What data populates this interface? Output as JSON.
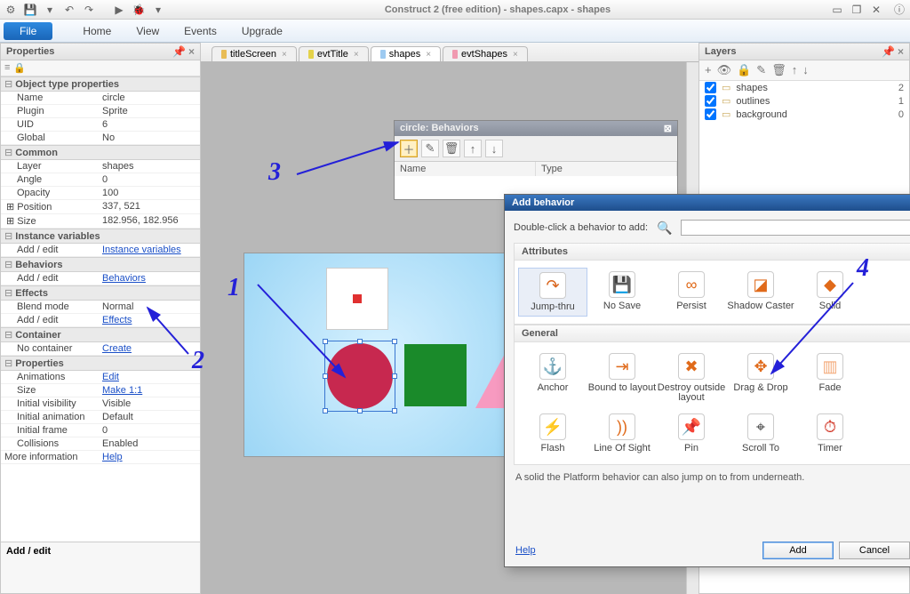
{
  "app_title": "Construct 2 (free edition) - shapes.capx - shapes",
  "menubar": {
    "file": "File",
    "items": [
      "Home",
      "View",
      "Events",
      "Upgrade"
    ]
  },
  "tabs": [
    {
      "label": "titleScreen",
      "color": "#e8bc55"
    },
    {
      "label": "evtTitle",
      "color": "#e4d24a"
    },
    {
      "label": "shapes",
      "color": "#9dcaf1",
      "active": true
    },
    {
      "label": "evtShapes",
      "color": "#f09ab0"
    }
  ],
  "props_panel": {
    "title": "Properties",
    "groups": [
      {
        "name": "Object type properties",
        "rows": [
          {
            "k": "Name",
            "v": "circle"
          },
          {
            "k": "Plugin",
            "v": "Sprite"
          },
          {
            "k": "UID",
            "v": "6"
          },
          {
            "k": "Global",
            "v": "No"
          }
        ]
      },
      {
        "name": "Common",
        "rows": [
          {
            "k": "Layer",
            "v": "shapes"
          },
          {
            "k": "Angle",
            "v": "0"
          },
          {
            "k": "Opacity",
            "v": "100"
          },
          {
            "k": "Position",
            "v": "337, 521",
            "exp": true
          },
          {
            "k": "Size",
            "v": "182.956, 182.956",
            "exp": true
          }
        ]
      },
      {
        "name": "Instance variables",
        "rows": [
          {
            "k": "Add / edit",
            "v": "Instance variables",
            "link": true
          }
        ]
      },
      {
        "name": "Behaviors",
        "rows": [
          {
            "k": "Add / edit",
            "v": "Behaviors",
            "link": true
          }
        ]
      },
      {
        "name": "Effects",
        "rows": [
          {
            "k": "Blend mode",
            "v": "Normal"
          },
          {
            "k": "Add / edit",
            "v": "Effects",
            "link": true
          }
        ]
      },
      {
        "name": "Container",
        "rows": [
          {
            "k": "No container",
            "v": "Create",
            "link": true
          }
        ]
      },
      {
        "name": "Properties",
        "rows": [
          {
            "k": "Animations",
            "v": "Edit",
            "link": true
          },
          {
            "k": "Size",
            "v": "Make 1:1",
            "link": true
          },
          {
            "k": "Initial visibility",
            "v": "Visible"
          },
          {
            "k": "Initial animation",
            "v": "Default"
          },
          {
            "k": "Initial frame",
            "v": "0"
          },
          {
            "k": "Collisions",
            "v": "Enabled"
          }
        ]
      }
    ],
    "more_info": {
      "k": "More information",
      "v": "Help"
    },
    "desc_title": "Add / edit"
  },
  "layers_panel": {
    "title": "Layers",
    "rows": [
      {
        "name": "shapes",
        "n": "2"
      },
      {
        "name": "outlines",
        "n": "1"
      },
      {
        "name": "background",
        "n": "0"
      }
    ]
  },
  "behaviors_dialog": {
    "title": "circle: Behaviors",
    "cols": [
      "Name",
      "Type"
    ]
  },
  "add_dialog": {
    "title": "Add behavior",
    "hint": "Double-click a behavior to add:",
    "search_placeholder": "",
    "sections": [
      {
        "title": "Attributes",
        "items": [
          {
            "label": "Jump-thru",
            "icon": "↷",
            "color": "#d9641b",
            "sel": true
          },
          {
            "label": "No Save",
            "icon": "💾",
            "color": "#555"
          },
          {
            "label": "Persist",
            "icon": "∞",
            "color": "#e06a1a"
          },
          {
            "label": "Shadow Caster",
            "icon": "◪",
            "color": "#e06a1a"
          },
          {
            "label": "Solid",
            "icon": "◆",
            "color": "#e06a1a"
          }
        ]
      },
      {
        "title": "General",
        "items": [
          {
            "label": "Anchor",
            "icon": "⚓",
            "color": "#e06a1a"
          },
          {
            "label": "Bound to layout",
            "icon": "⇥",
            "color": "#e06a1a"
          },
          {
            "label": "Destroy outside layout",
            "icon": "✖",
            "color": "#e06a1a"
          },
          {
            "label": "Drag & Drop",
            "icon": "✥",
            "color": "#e06a1a"
          },
          {
            "label": "Fade",
            "icon": "▥",
            "color": "#f3a978"
          },
          {
            "label": "Flash",
            "icon": "⚡",
            "color": "#f0a020"
          },
          {
            "label": "Line Of Sight",
            "icon": "))",
            "color": "#e06a1a"
          },
          {
            "label": "Pin",
            "icon": "📌",
            "color": "#e06a1a"
          },
          {
            "label": "Scroll To",
            "icon": "⌖",
            "color": "#444"
          },
          {
            "label": "Timer",
            "icon": "⏱",
            "color": "#d03020"
          }
        ]
      }
    ],
    "desc": "A solid the Platform behavior can also jump on to from underneath.",
    "help": "Help",
    "add_btn": "Add",
    "cancel_btn": "Cancel"
  },
  "annotations": {
    "n1": "1",
    "n2": "2",
    "n3": "3",
    "n4": "4"
  }
}
